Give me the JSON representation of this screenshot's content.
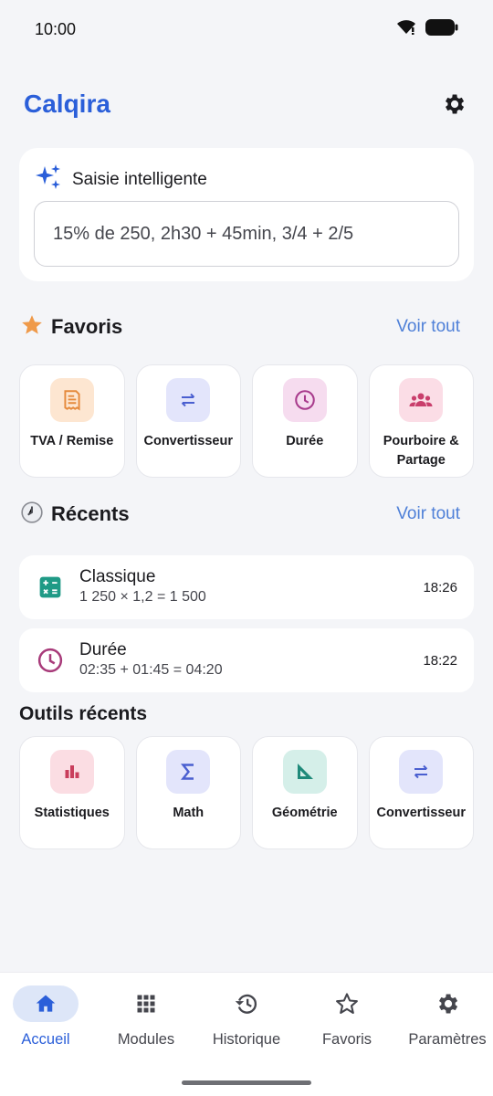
{
  "status_bar": {
    "time": "10:00"
  },
  "app": {
    "title": "Calqira"
  },
  "smart_input": {
    "title": "Saisie intelligente",
    "value": "15% de 250, 2h30 + 45min, 3/4 + 2/5"
  },
  "favorites": {
    "title": "Favoris",
    "see_all": "Voir tout",
    "items": [
      {
        "label": "TVA / Remise",
        "icon": "receipt-icon",
        "color": "#e58a3c",
        "bg": "#fde6d1"
      },
      {
        "label": "Convertisseur",
        "icon": "swap-icon",
        "color": "#4a5fd0",
        "bg": "#e3e5fb"
      },
      {
        "label": "Durée",
        "icon": "clock-icon",
        "color": "#a83b8c",
        "bg": "#f6dcef"
      },
      {
        "label": "Pourboire & Partage",
        "icon": "group-icon",
        "color": "#c93e6c",
        "bg": "#fbdde6"
      }
    ]
  },
  "recents": {
    "title": "Récents",
    "see_all": "Voir tout",
    "items": [
      {
        "title": "Classique",
        "expression": "1 250 × 1,2 = 1 500",
        "time": "18:26",
        "icon": "calculator-icon",
        "color": "#1f9a86"
      },
      {
        "title": "Durée",
        "expression": "02:35 + 01:45 = 04:20",
        "time": "18:22",
        "icon": "clock-icon",
        "color": "#a83b7a"
      }
    ]
  },
  "recent_tools": {
    "title": "Outils récents",
    "items": [
      {
        "label": "Statistiques",
        "icon": "bar-chart-icon",
        "color": "#c93e5c",
        "bg": "#fbdde3"
      },
      {
        "label": "Math",
        "icon": "sigma-icon",
        "color": "#4a5fd0",
        "bg": "#e3e5fb"
      },
      {
        "label": "Géométrie",
        "icon": "set-square-icon",
        "color": "#1f8a7a",
        "bg": "#d5efe9"
      },
      {
        "label": "Convertisseur",
        "icon": "swap-icon",
        "color": "#4a5fd0",
        "bg": "#e3e5fb"
      }
    ]
  },
  "bottom_nav": {
    "items": [
      {
        "label": "Accueil",
        "icon": "home-icon",
        "active": true
      },
      {
        "label": "Modules",
        "icon": "grid-icon",
        "active": false
      },
      {
        "label": "Historique",
        "icon": "history-icon",
        "active": false
      },
      {
        "label": "Favoris",
        "icon": "star-outline-icon",
        "active": false
      },
      {
        "label": "Paramètres",
        "icon": "gear-icon",
        "active": false
      }
    ]
  },
  "colors": {
    "accent": "#2b5fd9",
    "link": "#4f80d8",
    "background": "#f4f5f8"
  }
}
